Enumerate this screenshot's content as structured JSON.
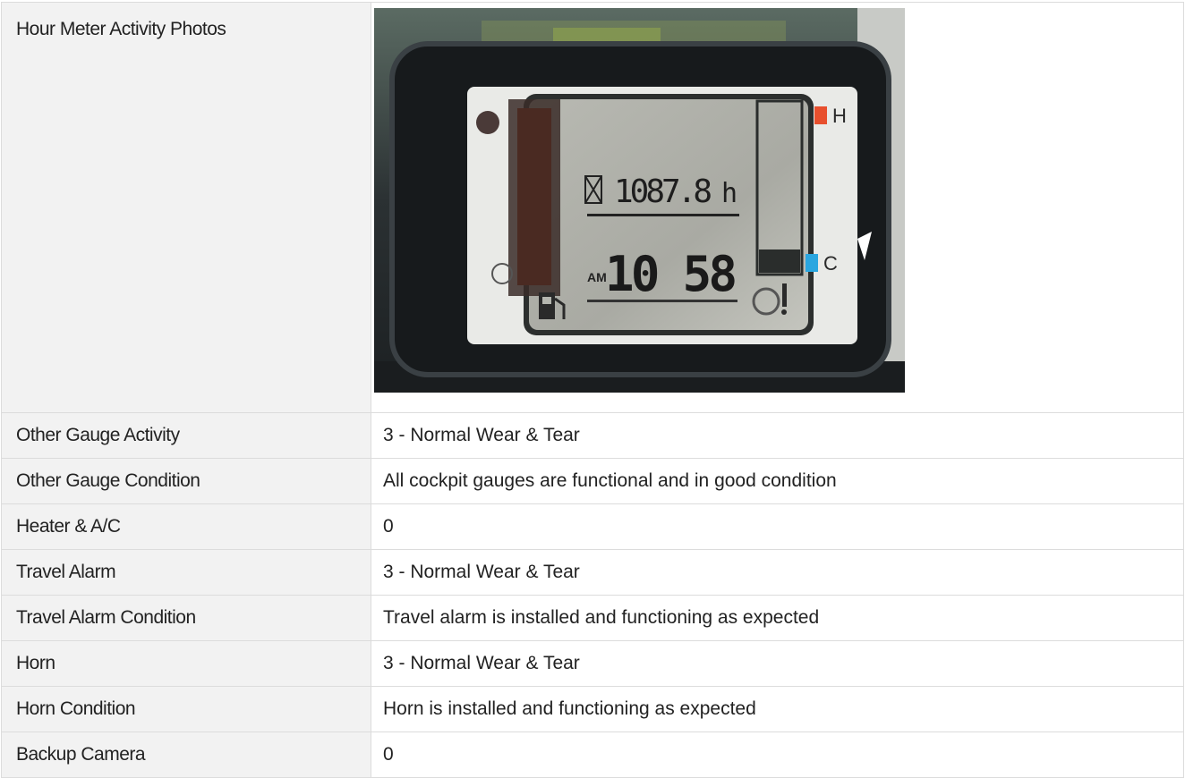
{
  "photo_row": {
    "label": "Hour Meter Activity Photos",
    "photo": {
      "hour_reading": "1087.8",
      "hour_unit": "h",
      "clock_meridiem": "AM",
      "clock_time": "10 58",
      "gauge_hot": "H",
      "gauge_cold": "C"
    }
  },
  "rows": [
    {
      "label": "Other Gauge Activity",
      "value": "3 - Normal Wear & Tear"
    },
    {
      "label": "Other Gauge Condition",
      "value": "All cockpit gauges are functional and in good condition"
    },
    {
      "label": "Heater & A/C",
      "value": "0"
    },
    {
      "label": "Travel Alarm",
      "value": "3 - Normal Wear & Tear"
    },
    {
      "label": "Travel Alarm Condition",
      "value": "Travel alarm is installed and functioning as expected"
    },
    {
      "label": "Horn",
      "value": "3 - Normal Wear & Tear"
    },
    {
      "label": "Horn Condition",
      "value": "Horn is installed and functioning as expected"
    },
    {
      "label": "Backup Camera",
      "value": "0"
    }
  ]
}
